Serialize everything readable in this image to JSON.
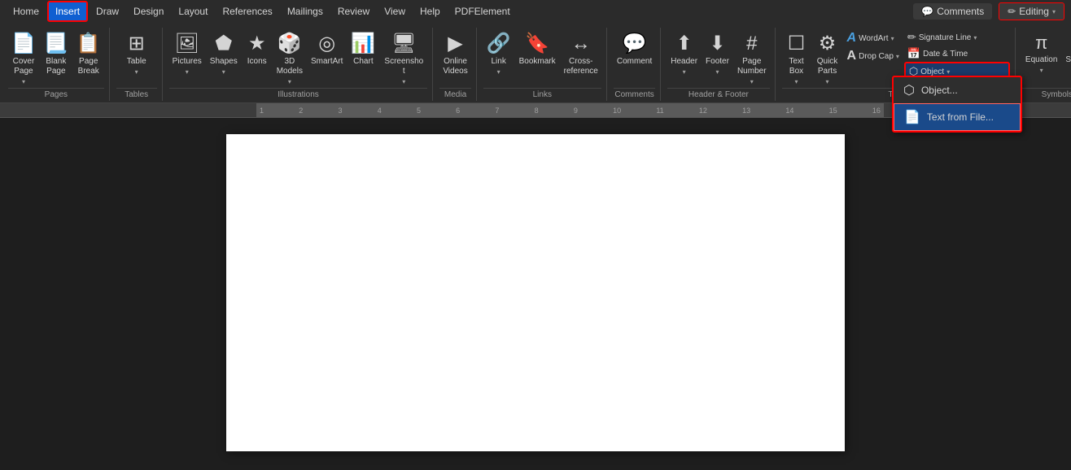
{
  "menubar": {
    "items": [
      "Home",
      "Insert",
      "Draw",
      "Design",
      "Layout",
      "References",
      "Mailings",
      "Review",
      "View",
      "Help",
      "PDFElement"
    ],
    "active_item": "Insert",
    "comments_label": "Comments",
    "editing_label": "Editing"
  },
  "ribbon": {
    "groups": [
      {
        "name": "pages",
        "label": "Pages",
        "buttons": [
          {
            "id": "cover-page",
            "icon": "📄",
            "label": "Cover\nPage",
            "dropdown": true
          },
          {
            "id": "blank-page",
            "icon": "📃",
            "label": "Blank\nPage"
          },
          {
            "id": "page-break",
            "icon": "📋",
            "label": "Page\nBreak"
          }
        ]
      },
      {
        "name": "tables",
        "label": "Tables",
        "buttons": [
          {
            "id": "table",
            "icon": "⊞",
            "label": "Table",
            "dropdown": true
          }
        ]
      },
      {
        "name": "illustrations",
        "label": "Illustrations",
        "buttons": [
          {
            "id": "pictures",
            "icon": "🖼",
            "label": "Pictures",
            "dropdown": true
          },
          {
            "id": "shapes",
            "icon": "⬟",
            "label": "Shapes",
            "dropdown": true
          },
          {
            "id": "icons",
            "icon": "★",
            "label": "Icons"
          },
          {
            "id": "3d-models",
            "icon": "🎲",
            "label": "3D\nModels",
            "dropdown": true
          },
          {
            "id": "smartart",
            "icon": "◎",
            "label": "SmartArt"
          },
          {
            "id": "chart",
            "icon": "📊",
            "label": "Chart"
          },
          {
            "id": "screenshot",
            "icon": "🖥",
            "label": "Screenshot",
            "dropdown": true
          }
        ]
      },
      {
        "name": "media",
        "label": "Media",
        "buttons": [
          {
            "id": "online-videos",
            "icon": "▶",
            "label": "Online\nVideos"
          }
        ]
      },
      {
        "name": "links",
        "label": "Links",
        "buttons": [
          {
            "id": "link",
            "icon": "🔗",
            "label": "Link",
            "dropdown": true
          },
          {
            "id": "bookmark",
            "icon": "🔖",
            "label": "Bookmark"
          },
          {
            "id": "cross-reference",
            "icon": "↔",
            "label": "Cross-\nreference"
          }
        ]
      },
      {
        "name": "comments",
        "label": "Comments",
        "buttons": [
          {
            "id": "comment",
            "icon": "💬",
            "label": "Comment"
          }
        ]
      },
      {
        "name": "header-footer",
        "label": "Header & Footer",
        "buttons": [
          {
            "id": "header",
            "icon": "⬆",
            "label": "Header",
            "dropdown": true
          },
          {
            "id": "footer",
            "icon": "⬇",
            "label": "Footer",
            "dropdown": true
          },
          {
            "id": "page-number",
            "icon": "#",
            "label": "Page\nNumber",
            "dropdown": true
          }
        ]
      },
      {
        "name": "text",
        "label": "Text",
        "buttons": [
          {
            "id": "text-box",
            "icon": "☐",
            "label": "Text\nBox",
            "dropdown": true
          },
          {
            "id": "quick-parts",
            "icon": "⚙",
            "label": "Quick\nParts",
            "dropdown": true
          },
          {
            "id": "wordart",
            "icon": "A",
            "label": "WordArt",
            "dropdown": true
          },
          {
            "id": "drop-cap",
            "icon": "A",
            "label": "Drop\nCap",
            "dropdown": true
          },
          {
            "id": "signature-line",
            "icon": "✏",
            "label": "Signature Line",
            "dropdown": true
          },
          {
            "id": "date-time",
            "icon": "📅",
            "label": "Date & Time"
          },
          {
            "id": "object",
            "icon": "⬡",
            "label": "Object",
            "dropdown": true,
            "highlighted": true
          }
        ]
      },
      {
        "name": "symbols",
        "label": "Symbols",
        "buttons": [
          {
            "id": "equation",
            "icon": "π",
            "label": "Equation",
            "dropdown": true
          },
          {
            "id": "symbol",
            "icon": "Ω",
            "label": "Sym..."
          }
        ]
      }
    ]
  },
  "object_dropdown": {
    "items": [
      {
        "id": "object-item",
        "icon": "⬡",
        "label": "Object..."
      },
      {
        "id": "text-from-file",
        "icon": "📄",
        "label": "Text from File...",
        "highlighted": true
      }
    ]
  },
  "document": {
    "page_background": "#ffffff"
  }
}
